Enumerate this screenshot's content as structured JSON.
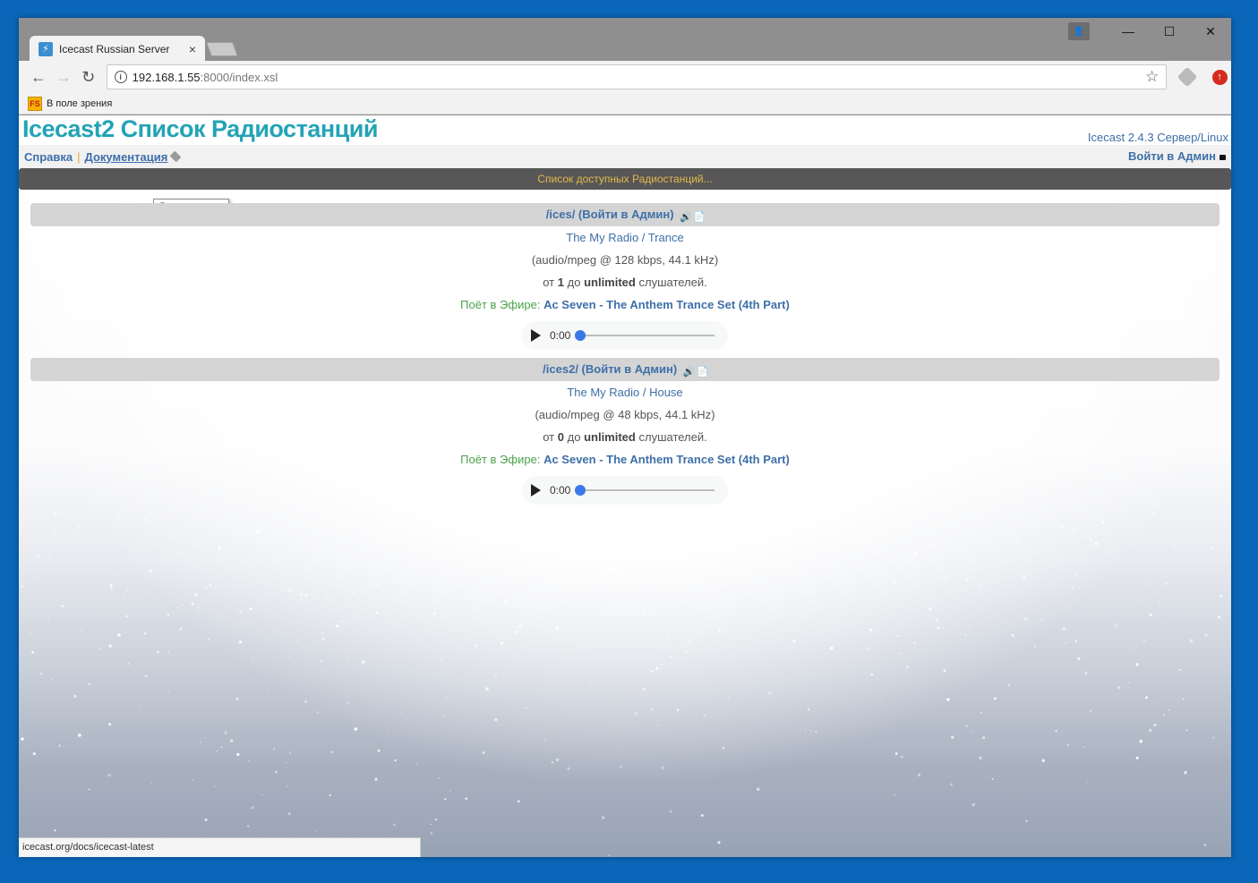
{
  "browser": {
    "tab": {
      "title": "Icecast Russian Server",
      "close_glyph": "×",
      "favicon_glyph": "⚡"
    },
    "window_controls": {
      "minimize": "—",
      "maximize": "☐",
      "close": "✕"
    },
    "nav": {
      "back": "←",
      "forward": "→",
      "reload": "↻"
    },
    "address": {
      "host": "192.168.1.55",
      "path": ":8000/index.xsl",
      "info_glyph": "i",
      "star_glyph": "☆"
    },
    "bookmark": {
      "icon_text": "FS",
      "label": "В поле зрения"
    },
    "status_url": "icecast.org/docs/icecast-latest"
  },
  "page": {
    "title": "Icecast2 Список Радиостанций",
    "server_version": "Icecast 2.4.3 Сервер/Linux",
    "menu": {
      "help": "Справка",
      "separator": "|",
      "docs": "Документация",
      "admin": "Войти в Админ"
    },
    "tooltip": "Документация",
    "banner": "Список доступных Радиостанций..."
  },
  "mounts": [
    {
      "header": "/ices/ (Войти в Админ)",
      "station": "The My Radio / Trance",
      "format": "(audio/mpeg @ 128 kbps, 44.1 kHz)",
      "listeners_prefix": "от",
      "listeners_count": "1",
      "listeners_mid": "до",
      "listeners_max": "unlimited",
      "listeners_suffix": "слушателей.",
      "onair_label": "Поёт в Эфире:",
      "onair_song": "Ac Seven - The Anthem Trance Set (4th Part)",
      "player_time": "0:00",
      "player_progress": 0
    },
    {
      "header": "/ices2/ (Войти в Админ)",
      "station": "The My Radio / House",
      "format": "(audio/mpeg @ 48 kbps, 44.1 kHz)",
      "listeners_prefix": "от",
      "listeners_count": "0",
      "listeners_mid": "до",
      "listeners_max": "unlimited",
      "listeners_suffix": "слушателей.",
      "onair_label": "Поёт в Эфире:",
      "onair_song": "Ac Seven - The Anthem Trance Set (4th Part)",
      "player_time": "0:00",
      "player_progress": 0
    }
  ],
  "colors": {
    "title": "#23a3b6",
    "link": "#3e6fa8",
    "banner_bg": "#575757",
    "banner_text": "#e4b84b",
    "onair_label": "#4aa24a",
    "player_accent": "#3b78e7",
    "desktop": "#0a66b8"
  }
}
